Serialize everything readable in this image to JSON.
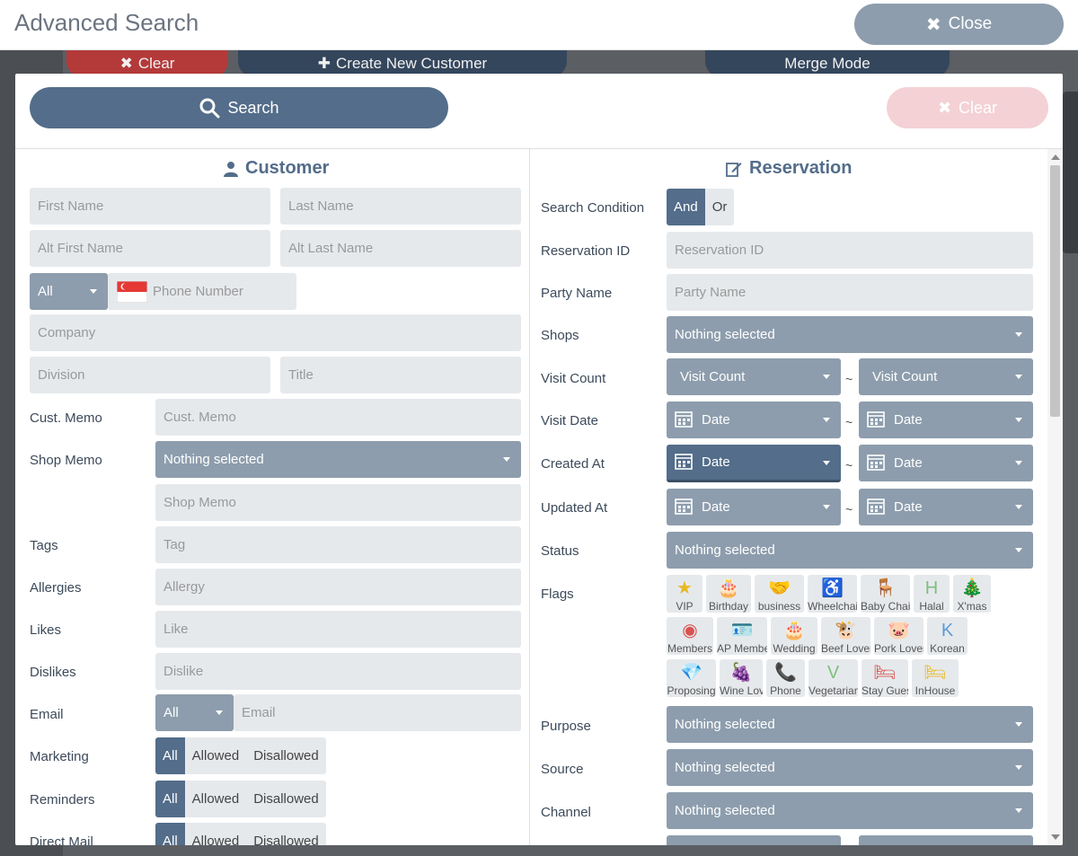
{
  "page": {
    "title": "Advanced Search",
    "close_label": "Close"
  },
  "background": {
    "clear_label": "Clear",
    "create_label": "Create New Customer",
    "merge_label": "Merge Mode"
  },
  "modal": {
    "search_label": "Search",
    "clear_label": "Clear"
  },
  "customer": {
    "title": "Customer",
    "first_name_ph": "First Name",
    "last_name_ph": "Last Name",
    "alt_first_ph": "Alt First Name",
    "alt_last_ph": "Alt Last Name",
    "phone_scope": "All",
    "phone_ph": "Phone Number",
    "company_ph": "Company",
    "division_ph": "Division",
    "title_ph": "Title",
    "cust_memo_label": "Cust. Memo",
    "cust_memo_ph": "Cust. Memo",
    "shop_memo_label": "Shop Memo",
    "shop_memo_select": "Nothing selected",
    "shop_memo_ph": "Shop Memo",
    "tags_label": "Tags",
    "tags_ph": "Tag",
    "allergies_label": "Allergies",
    "allergies_ph": "Allergy",
    "likes_label": "Likes",
    "likes_ph": "Like",
    "dislikes_label": "Dislikes",
    "dislikes_ph": "Dislike",
    "email_label": "Email",
    "email_scope": "All",
    "email_ph": "Email",
    "marketing_label": "Marketing",
    "reminders_label": "Reminders",
    "direct_mail_label": "Direct Mail",
    "seg_all": "All",
    "seg_allowed": "Allowed",
    "seg_disallowed": "Disallowed"
  },
  "reservation": {
    "title": "Reservation",
    "search_condition_label": "Search Condition",
    "cond_and": "And",
    "cond_or": "Or",
    "res_id_label": "Reservation ID",
    "res_id_ph": "Reservation ID",
    "party_label": "Party Name",
    "party_ph": "Party Name",
    "shops_label": "Shops",
    "nothing_selected": "Nothing selected",
    "visit_count_label": "Visit Count",
    "visit_count_select": "Visit Count",
    "visit_date_label": "Visit Date",
    "created_label": "Created At",
    "updated_label": "Updated At",
    "date_label": "Date",
    "tilde": "~",
    "status_label": "Status",
    "flags_label": "Flags",
    "purpose_label": "Purpose",
    "source_label": "Source",
    "channel_label": "Channel",
    "flags": [
      {
        "label": "VIP",
        "icon": "★",
        "color": "#e8b923"
      },
      {
        "label": "Birthday",
        "icon": "🎂",
        "color": "#d9534f"
      },
      {
        "label": "business",
        "icon": "🤝",
        "color": "#7fbf7f"
      },
      {
        "label": "Wheelchair",
        "icon": "♿",
        "color": "#e8b923"
      },
      {
        "label": "Baby Chair",
        "icon": "🪑",
        "color": "#d9534f"
      },
      {
        "label": "Halal",
        "icon": "H",
        "color": "#7fbf7f"
      },
      {
        "label": "X'mas",
        "icon": "🎄",
        "color": "#9b59b6"
      },
      {
        "label": "Members",
        "icon": "◉",
        "color": "#d9534f"
      },
      {
        "label": "AP Member",
        "icon": "🪪",
        "color": "#d9534f"
      },
      {
        "label": "Wedding",
        "icon": "🎂",
        "color": "#d9534f"
      },
      {
        "label": "Beef Lover",
        "icon": "🐮",
        "color": "#555"
      },
      {
        "label": "Pork Lover",
        "icon": "🐷",
        "color": "#d9534f"
      },
      {
        "label": "Korean",
        "icon": "K",
        "color": "#5b9bd5"
      },
      {
        "label": "Proposing",
        "icon": "💎",
        "color": "#e8b923"
      },
      {
        "label": "Wine Lover",
        "icon": "🍇",
        "color": "#d9534f"
      },
      {
        "label": "Phone",
        "icon": "📞",
        "color": "#5b9bd5"
      },
      {
        "label": "Vegetarian",
        "icon": "V",
        "color": "#7fbf7f"
      },
      {
        "label": "Stay Guest",
        "icon": "🛏",
        "color": "#d9534f"
      },
      {
        "label": "InHouse",
        "icon": "🛏",
        "color": "#e8b923"
      }
    ]
  }
}
